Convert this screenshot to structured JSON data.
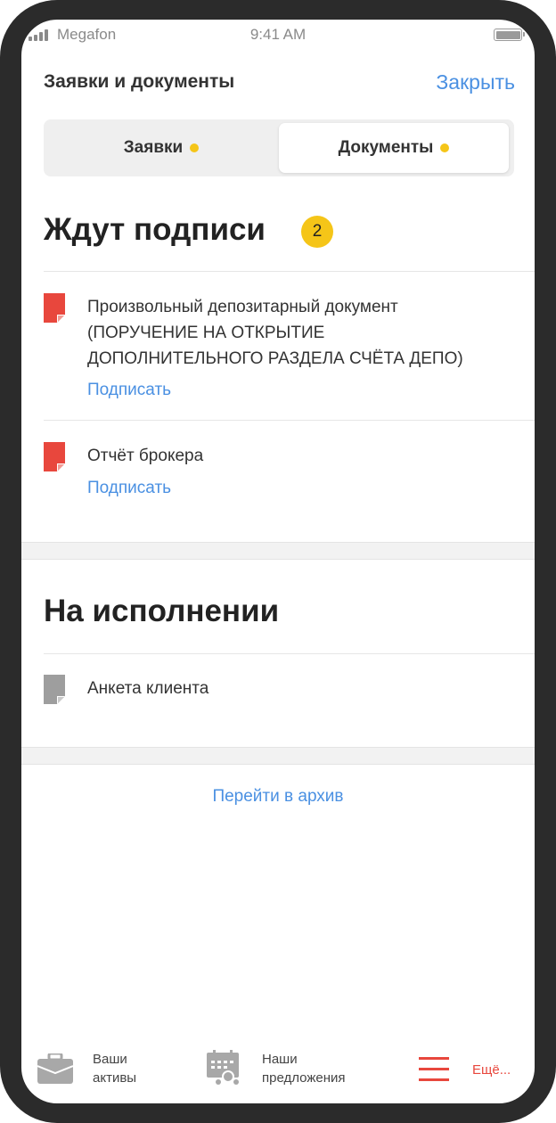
{
  "status_bar": {
    "carrier": "Megafon",
    "time": "9:41 AM"
  },
  "header": {
    "title": "Заявки и документы",
    "close_label": "Закрыть"
  },
  "tabs": [
    {
      "label": "Заявки",
      "selected": false
    },
    {
      "label": "Документы",
      "selected": true
    }
  ],
  "awaiting": {
    "title": "Ждут подписи",
    "count": "2",
    "items": [
      {
        "title_line1": "Произвольный депозитарный документ",
        "title_line2": "(ПОРУЧЕНИЕ НА ОТКРЫТИЕ",
        "title_line3": "ДОПОЛНИТЕЛЬНОГО РАЗДЕЛА СЧЁТА ДЕПО)",
        "action": "Подписать"
      },
      {
        "title_line1": "Отчёт брокера",
        "action": "Подписать"
      }
    ]
  },
  "in_progress": {
    "title": "На исполнении",
    "items": [
      {
        "title": "Анкета клиента"
      }
    ]
  },
  "archive_link": "Перейти в архив",
  "bottom_bar": {
    "assets": {
      "line1": "Ваши",
      "line2": "активы"
    },
    "offers": {
      "line1": "Наши",
      "line2": "предложения"
    },
    "more": {
      "label": "Ещё..."
    }
  },
  "colors": {
    "accent_blue": "#4a90e2",
    "badge_yellow": "#f5c518",
    "doc_red": "#e8473d",
    "doc_gray": "#9e9e9e"
  }
}
